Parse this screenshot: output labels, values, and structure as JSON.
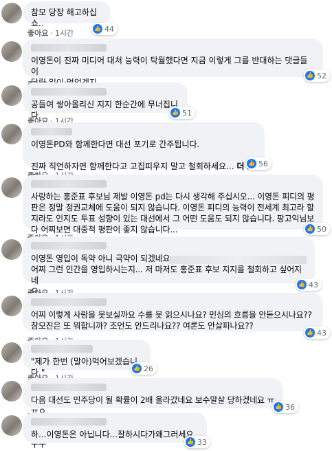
{
  "reaction": {
    "like_label": "좋아요",
    "time": "1시간"
  },
  "comments": [
    {
      "text": "참모 당장 해고하십쇼..",
      "count": "44"
    },
    {
      "text": "이영돈이 진짜 미디어 대처 능력이 탁월했다면 지금 이렇게 그를 반대하는 댓글들이\n달릴 일이 없었겠지.",
      "count": "52"
    },
    {
      "text": "공들여 쌓아올리신 지지 한순간에 무너집니다.",
      "count": "51"
    },
    {
      "text": "이영돈PD와 함께한다면 대선 포기로 간주됩니다.\n\n진짜 직언하자면 함께한다고 고집피우지 말고 철회하세요...",
      "more": "더 보기",
      "count": "56"
    },
    {
      "text": "사랑하는 홍준표 후보님 제발 이영돈 pd는 다시 생각해 주십시오... 이영돈 피디의 평\n판은 정말 정권교체에 도움이 되지 않습니다. 이영돈 피디의 능력이 전세계 최고라 할\n지라도 인지도 투표 성향이 있는 대선에서 그 어떤 도움도 되지 않습니다. 팡고익님보\n다 어찌보면 대중적 평판이 좋지 않습니다...",
      "count": "50"
    },
    {
      "text": "이영돈 영입이 독약 아니 극약이 되겠네요\n어찌 그런 인간을 영입하시는지... 저 마저도 홍준표 후보 지지를 철회하고 싶어지네\n요..",
      "count": "43"
    },
    {
      "text": "어찌 이렇게 사람을 못보실까요 수를 못 읽으시나요? 민심의 흐름을 안듣으시나요??\n참모진은 또 뭐합니까? 조언도 안드리나요?? 여론도 안살피나요??",
      "count": "43"
    },
    {
      "text": "\"제가 한번 (말아)먹어보겠습니다.\"",
      "count": "26"
    },
    {
      "text": "다음 대선도 민주당이 될 확률이 2배 올라갔네요 보수말살 당하겠네요 ㅠㅠㅇ",
      "count": "36"
    },
    {
      "text": "하...이영돈은 아닙니다...잘하시다가왜그러세요.ㅜㅜ",
      "count": "33"
    }
  ]
}
